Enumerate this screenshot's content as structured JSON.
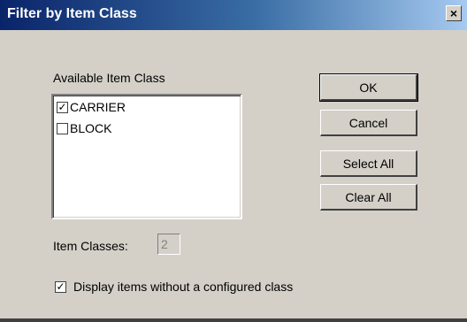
{
  "window": {
    "title": "Filter by Item Class",
    "close_glyph": "×"
  },
  "list": {
    "label": "Available Item Class",
    "items": [
      {
        "label": "CARRIER",
        "checked": true
      },
      {
        "label": "BLOCK",
        "checked": false
      }
    ]
  },
  "buttons": {
    "ok": "OK",
    "cancel": "Cancel",
    "select_all": "Select All",
    "clear_all": "Clear All"
  },
  "item_classes": {
    "label": "Item Classes:",
    "value": "2"
  },
  "display_option": {
    "label": "Display items without a configured class",
    "checked": true
  },
  "icons": {
    "check": "✓"
  }
}
